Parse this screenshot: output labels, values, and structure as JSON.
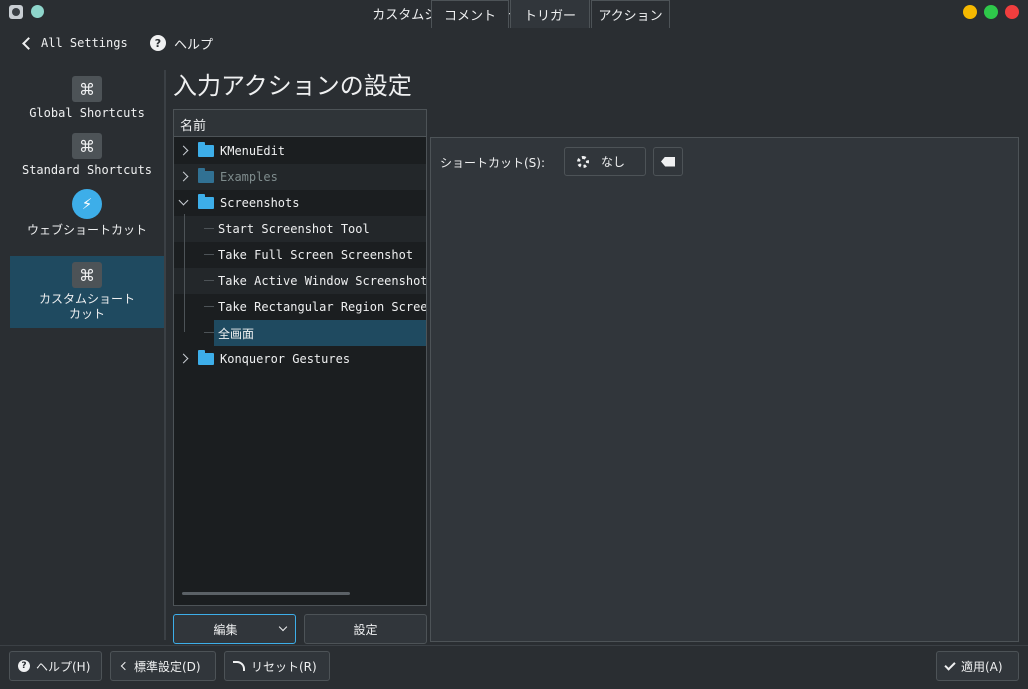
{
  "window": {
    "title": "カスタムショートカット * — KDE システム設定",
    "button_colors": {
      "minimize": "#f5b800",
      "maximize": "#2ec84a",
      "close": "#f03e3e"
    }
  },
  "topnav": {
    "back_label": "All Settings",
    "help_label": "ヘルプ"
  },
  "sidebar": {
    "items": [
      {
        "label": "Global Shortcuts",
        "icon": "command-icon"
      },
      {
        "label": "Standard Shortcuts",
        "icon": "command-icon"
      },
      {
        "label": "ウェブショートカット",
        "icon": "web-shortcut-icon"
      },
      {
        "label": "カスタムショート\nカット",
        "icon": "command-icon",
        "selected": true
      }
    ]
  },
  "page": {
    "title": "入力アクションの設定"
  },
  "tree": {
    "header": "名前",
    "rows": [
      {
        "label": "KMenuEdit",
        "type": "folder",
        "expanded": false
      },
      {
        "label": "Examples",
        "type": "folder",
        "expanded": false,
        "disabled": true
      },
      {
        "label": "Screenshots",
        "type": "folder",
        "expanded": true
      },
      {
        "label": "Start Screenshot Tool",
        "type": "action"
      },
      {
        "label": "Take Full Screen Screenshot",
        "type": "action"
      },
      {
        "label": "Take Active Window Screenshot",
        "type": "action"
      },
      {
        "label": "Take Rectangular Region Screensh",
        "type": "action"
      },
      {
        "label": "全画面",
        "type": "action",
        "selected": true
      },
      {
        "label": "Konqueror Gestures",
        "type": "folder",
        "expanded": false
      }
    ]
  },
  "tree_buttons": {
    "edit": "編集",
    "settings": "設定"
  },
  "tabs": [
    {
      "label": "コメント"
    },
    {
      "label": "トリガー",
      "active": true
    },
    {
      "label": "アクション"
    }
  ],
  "trigger": {
    "shortcut_label": "ショートカット(S):",
    "shortcut_value": "なし"
  },
  "footer": {
    "help": "ヘルプ(H)",
    "defaults": "標準設定(D)",
    "reset": "リセット(R)",
    "apply": "適用(A)"
  },
  "colors": {
    "accent": "#3daee9",
    "selection": "#1f4a60",
    "background": "#2a2e32"
  }
}
